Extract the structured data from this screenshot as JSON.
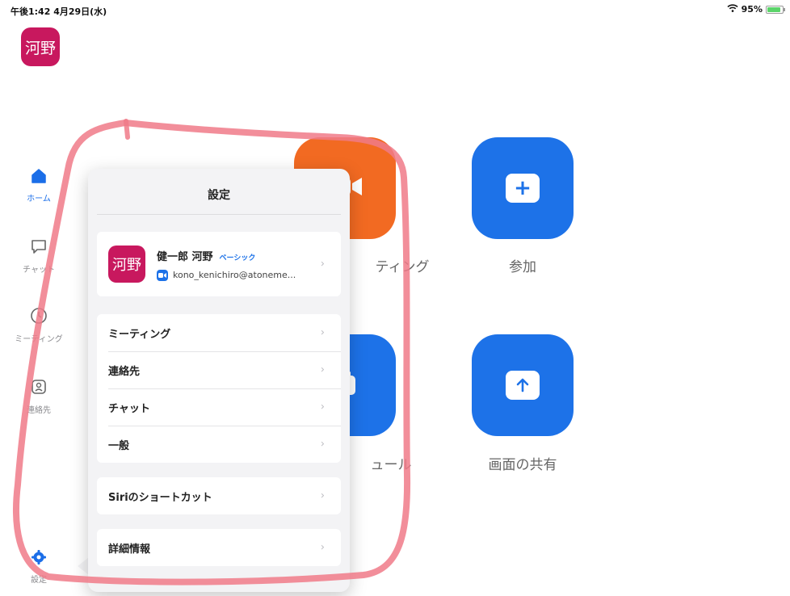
{
  "status_bar": {
    "time": "午後1:42 4月29日(水)",
    "signal": "95%"
  },
  "user_avatar_text": "河野",
  "sidebar": {
    "items": [
      {
        "label": "ホーム",
        "icon": "home-icon"
      },
      {
        "label": "チャット",
        "icon": "chat-bubble-icon"
      },
      {
        "label": "ミーティング",
        "icon": "clock-icon"
      },
      {
        "label": "連絡先",
        "icon": "contact-icon"
      },
      {
        "label": "設定",
        "icon": "gear-icon"
      }
    ]
  },
  "main": {
    "tiles": [
      {
        "label": "ティング",
        "icon": "video-camera-icon",
        "color": "#f26a22"
      },
      {
        "label": "参加",
        "icon": "plus-icon",
        "color": "#1d72e8"
      },
      {
        "label": "ュール",
        "icon": "calendar-icon",
        "color": "#1d72e8"
      },
      {
        "label": "画面の共有",
        "icon": "share-up-arrow-icon",
        "color": "#1d72e8"
      }
    ]
  },
  "settings_popover": {
    "title": "設定",
    "profile": {
      "avatar_text": "河野",
      "name": "健一郎 河野",
      "plan": "ベーシック",
      "email": "kono_kenichiro@atoneme..."
    },
    "group1": [
      "ミーティング",
      "連絡先",
      "チャット",
      "一般"
    ],
    "group2": [
      "Siriのショートカット"
    ],
    "group3": [
      "詳細情報"
    ]
  },
  "colors": {
    "accent": "#1d72e8",
    "avatar": "#c8185e",
    "annotation": "#f07a88"
  }
}
